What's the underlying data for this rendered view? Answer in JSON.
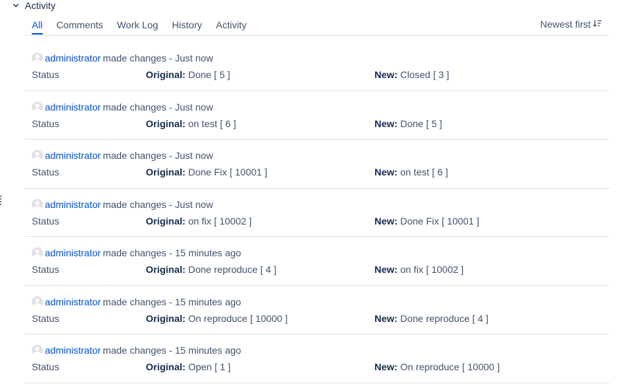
{
  "section": {
    "title": "Activity"
  },
  "tabs": [
    {
      "label": "All",
      "active": true
    },
    {
      "label": "Comments",
      "active": false
    },
    {
      "label": "Work Log",
      "active": false
    },
    {
      "label": "History",
      "active": false
    },
    {
      "label": "Activity",
      "active": false
    }
  ],
  "sort": {
    "label": "Newest first"
  },
  "labels": {
    "original": "Original:",
    "new": "New:"
  },
  "entries": [
    {
      "user": "administrator",
      "action": "made changes - Just now",
      "field": "Status",
      "original": "Done [ 5 ]",
      "new": "Closed [ 3 ]"
    },
    {
      "user": "administrator",
      "action": "made changes - Just now",
      "field": "Status",
      "original": "on test [ 6 ]",
      "new": "Done [ 5 ]"
    },
    {
      "user": "administrator",
      "action": "made changes - Just now",
      "field": "Status",
      "original": "Done Fix [ 10001 ]",
      "new": "on test [ 6 ]"
    },
    {
      "user": "administrator",
      "action": "made changes - Just now",
      "field": "Status",
      "original": "on fix [ 10002 ]",
      "new": "Done Fix [ 10001 ]"
    },
    {
      "user": "administrator",
      "action": "made changes - 15 minutes ago",
      "field": "Status",
      "original": "Done reproduce [ 4 ]",
      "new": "on fix [ 10002 ]"
    },
    {
      "user": "administrator",
      "action": "made changes - 15 minutes ago",
      "field": "Status",
      "original": "On reproduce [ 10000 ]",
      "new": "Done reproduce [ 4 ]"
    },
    {
      "user": "administrator",
      "action": "made changes - 15 minutes ago",
      "field": "Status",
      "original": "Open [ 1 ]",
      "new": "On reproduce [ 10000 ]"
    }
  ],
  "colors": {
    "link": "#0052cc",
    "text": "#42526e",
    "border": "#dfe1e6"
  },
  "icons": {
    "collapse": "chevron-down-icon",
    "sort": "sort-descending-icon",
    "avatar": "default-avatar-icon",
    "handle": "drag-handle-icon"
  }
}
